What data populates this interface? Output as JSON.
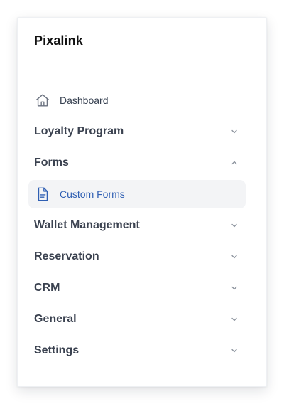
{
  "brand": {
    "title": "Pixalink"
  },
  "nav": {
    "dashboard": {
      "label": "Dashboard",
      "icon": "home-icon"
    },
    "loyalty": {
      "label": "Loyalty Program",
      "icon": "chevron-down-icon"
    },
    "forms": {
      "label": "Forms",
      "icon": "chevron-up-icon",
      "expanded": true
    },
    "custom_forms": {
      "label": "Custom Forms",
      "icon": "document-icon",
      "active": true
    },
    "wallet": {
      "label": "Wallet Management",
      "icon": "chevron-down-icon"
    },
    "reservation": {
      "label": "Reservation",
      "icon": "chevron-down-icon"
    },
    "crm": {
      "label": "CRM",
      "icon": "chevron-down-icon"
    },
    "general": {
      "label": "General",
      "icon": "chevron-down-icon"
    },
    "settings": {
      "label": "Settings",
      "icon": "chevron-down-icon"
    }
  },
  "colors": {
    "active_bg": "#f3f4f6",
    "active_text": "#2f5fb3",
    "group_text": "#3b4250",
    "chevron": "#8a919c"
  }
}
